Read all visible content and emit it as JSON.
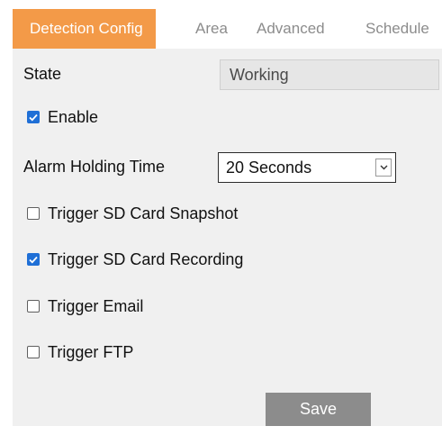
{
  "tabs": [
    {
      "label": "Detection Config",
      "active": true
    },
    {
      "label": "Area",
      "active": false
    },
    {
      "label": "Advanced",
      "active": false
    },
    {
      "label": "Schedule",
      "active": false
    }
  ],
  "state": {
    "label": "State",
    "value": "Working"
  },
  "enable": {
    "label": "Enable",
    "checked": true
  },
  "alarm_holding_time": {
    "label": "Alarm Holding Time",
    "selected": "20 Seconds"
  },
  "triggers": [
    {
      "label": "Trigger SD Card Snapshot",
      "checked": false
    },
    {
      "label": "Trigger SD Card Recording",
      "checked": true
    },
    {
      "label": "Trigger Email",
      "checked": false
    },
    {
      "label": "Trigger FTP",
      "checked": false
    }
  ],
  "save_label": "Save",
  "colors": {
    "accent_tab": "#f39a48",
    "checkbox": "#1f6fd6",
    "button": "#8c8c8c"
  },
  "icons": {
    "dropdown": "chevron-down-icon",
    "check": "checkmark-icon"
  }
}
